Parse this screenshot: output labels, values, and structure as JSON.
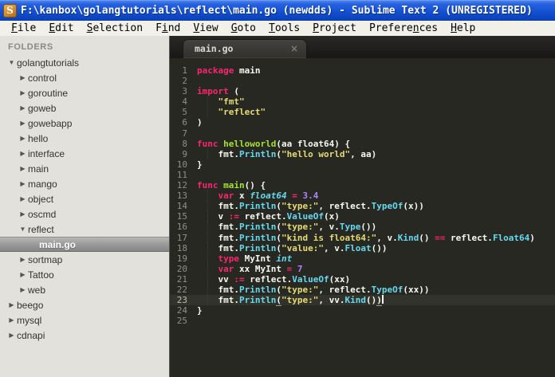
{
  "window": {
    "title": "F:\\kanbox\\golangtutorials\\reflect\\main.go (newdds) - Sublime Text 2 (UNREGISTERED)",
    "app_icon_letter": "S"
  },
  "menu": {
    "items": [
      {
        "label": "File",
        "u": 0
      },
      {
        "label": "Edit",
        "u": 0
      },
      {
        "label": "Selection",
        "u": 0
      },
      {
        "label": "Find",
        "u": 1
      },
      {
        "label": "View",
        "u": 0
      },
      {
        "label": "Goto",
        "u": 0
      },
      {
        "label": "Tools",
        "u": 0
      },
      {
        "label": "Project",
        "u": 0
      },
      {
        "label": "Preferences",
        "u": 7
      },
      {
        "label": "Help",
        "u": 0
      }
    ]
  },
  "icons": {
    "expanded": "▼",
    "collapsed": "▶",
    "close": "×"
  },
  "sidebar": {
    "header": "FOLDERS",
    "items": [
      {
        "label": "golangtutorials",
        "level": 0,
        "state": "expanded",
        "selected": false
      },
      {
        "label": "control",
        "level": 1,
        "state": "collapsed",
        "selected": false
      },
      {
        "label": "goroutine",
        "level": 1,
        "state": "collapsed",
        "selected": false
      },
      {
        "label": "goweb",
        "level": 1,
        "state": "collapsed",
        "selected": false
      },
      {
        "label": "gowebapp",
        "level": 1,
        "state": "collapsed",
        "selected": false
      },
      {
        "label": "hello",
        "level": 1,
        "state": "collapsed",
        "selected": false
      },
      {
        "label": "interface",
        "level": 1,
        "state": "collapsed",
        "selected": false
      },
      {
        "label": "main",
        "level": 1,
        "state": "collapsed",
        "selected": false
      },
      {
        "label": "mango",
        "level": 1,
        "state": "collapsed",
        "selected": false
      },
      {
        "label": "object",
        "level": 1,
        "state": "collapsed",
        "selected": false
      },
      {
        "label": "oscmd",
        "level": 1,
        "state": "collapsed",
        "selected": false
      },
      {
        "label": "reflect",
        "level": 1,
        "state": "expanded",
        "selected": false
      },
      {
        "label": "main.go",
        "level": 2,
        "state": "file",
        "selected": true
      },
      {
        "label": "sortmap",
        "level": 1,
        "state": "collapsed",
        "selected": false
      },
      {
        "label": "Tattoo",
        "level": 1,
        "state": "collapsed",
        "selected": false
      },
      {
        "label": "web",
        "level": 1,
        "state": "collapsed",
        "selected": false
      },
      {
        "label": "beego",
        "level": 0,
        "state": "collapsed",
        "selected": false
      },
      {
        "label": "mysql",
        "level": 0,
        "state": "collapsed",
        "selected": false
      },
      {
        "label": "cdnapi",
        "level": 0,
        "state": "collapsed",
        "selected": false
      }
    ]
  },
  "tab": {
    "label": "main.go",
    "active": true
  },
  "editor": {
    "language": "Go",
    "total_lines": 25,
    "current_line": 23,
    "cursor_line": 23,
    "lines": [
      [
        {
          "t": "package",
          "c": "k"
        },
        {
          "t": " main",
          "c": "p"
        }
      ],
      [],
      [
        {
          "t": "import",
          "c": "k"
        },
        {
          "t": " (",
          "c": "p"
        }
      ],
      [
        {
          "t": "    ",
          "c": "p"
        },
        {
          "t": "\"fmt\"",
          "c": "s"
        }
      ],
      [
        {
          "t": "    ",
          "c": "p"
        },
        {
          "t": "\"reflect\"",
          "c": "s"
        }
      ],
      [
        {
          "t": ")",
          "c": "p"
        }
      ],
      [],
      [
        {
          "t": "func ",
          "c": "k"
        },
        {
          "t": "helloworld",
          "c": "g"
        },
        {
          "t": "(aa float64) {",
          "c": "p"
        }
      ],
      [
        {
          "t": "    ",
          "c": "p"
        },
        {
          "t": "fmt.",
          "c": "p"
        },
        {
          "t": "Println",
          "c": "c"
        },
        {
          "t": "(",
          "c": "p"
        },
        {
          "t": "\"hello world\"",
          "c": "s"
        },
        {
          "t": ", aa)",
          "c": "p"
        }
      ],
      [
        {
          "t": "}",
          "c": "p"
        }
      ],
      [],
      [
        {
          "t": "func ",
          "c": "k"
        },
        {
          "t": "main",
          "c": "g"
        },
        {
          "t": "() {",
          "c": "p"
        }
      ],
      [
        {
          "t": "    ",
          "c": "p"
        },
        {
          "t": "var",
          "c": "k"
        },
        {
          "t": " x ",
          "c": "p"
        },
        {
          "t": "float64",
          "c": "ci"
        },
        {
          "t": " ",
          "c": "p"
        },
        {
          "t": "=",
          "c": "k"
        },
        {
          "t": " ",
          "c": "p"
        },
        {
          "t": "3.4",
          "c": "n"
        }
      ],
      [
        {
          "t": "    ",
          "c": "p"
        },
        {
          "t": "fmt.",
          "c": "p"
        },
        {
          "t": "Println",
          "c": "c"
        },
        {
          "t": "(",
          "c": "p"
        },
        {
          "t": "\"type:\"",
          "c": "s"
        },
        {
          "t": ", reflect.",
          "c": "p"
        },
        {
          "t": "TypeOf",
          "c": "c"
        },
        {
          "t": "(x))",
          "c": "p"
        }
      ],
      [
        {
          "t": "    ",
          "c": "p"
        },
        {
          "t": "v ",
          "c": "p"
        },
        {
          "t": ":=",
          "c": "k"
        },
        {
          "t": " reflect.",
          "c": "p"
        },
        {
          "t": "ValueOf",
          "c": "c"
        },
        {
          "t": "(x)",
          "c": "p"
        }
      ],
      [
        {
          "t": "    ",
          "c": "p"
        },
        {
          "t": "fmt.",
          "c": "p"
        },
        {
          "t": "Println",
          "c": "c"
        },
        {
          "t": "(",
          "c": "p"
        },
        {
          "t": "\"type:\"",
          "c": "s"
        },
        {
          "t": ", v.",
          "c": "p"
        },
        {
          "t": "Type",
          "c": "c"
        },
        {
          "t": "())",
          "c": "p"
        }
      ],
      [
        {
          "t": "    ",
          "c": "p"
        },
        {
          "t": "fmt.",
          "c": "p"
        },
        {
          "t": "Println",
          "c": "c"
        },
        {
          "t": "(",
          "c": "p"
        },
        {
          "t": "\"kind is float64:\"",
          "c": "s"
        },
        {
          "t": ", v.",
          "c": "p"
        },
        {
          "t": "Kind",
          "c": "c"
        },
        {
          "t": "() ",
          "c": "p"
        },
        {
          "t": "==",
          "c": "k"
        },
        {
          "t": " reflect.",
          "c": "p"
        },
        {
          "t": "Float64",
          "c": "c"
        },
        {
          "t": ")",
          "c": "p"
        }
      ],
      [
        {
          "t": "    ",
          "c": "p"
        },
        {
          "t": "fmt.",
          "c": "p"
        },
        {
          "t": "Println",
          "c": "c"
        },
        {
          "t": "(",
          "c": "p"
        },
        {
          "t": "\"value:\"",
          "c": "s"
        },
        {
          "t": ", v.",
          "c": "p"
        },
        {
          "t": "Float",
          "c": "c"
        },
        {
          "t": "())",
          "c": "p"
        }
      ],
      [
        {
          "t": "    ",
          "c": "p"
        },
        {
          "t": "type",
          "c": "k"
        },
        {
          "t": " MyInt ",
          "c": "p"
        },
        {
          "t": "int",
          "c": "ci"
        }
      ],
      [
        {
          "t": "    ",
          "c": "p"
        },
        {
          "t": "var",
          "c": "k"
        },
        {
          "t": " xx MyInt ",
          "c": "p"
        },
        {
          "t": "=",
          "c": "k"
        },
        {
          "t": " ",
          "c": "p"
        },
        {
          "t": "7",
          "c": "n"
        }
      ],
      [
        {
          "t": "    ",
          "c": "p"
        },
        {
          "t": "vv ",
          "c": "p"
        },
        {
          "t": ":=",
          "c": "k"
        },
        {
          "t": " reflect.",
          "c": "p"
        },
        {
          "t": "ValueOf",
          "c": "c"
        },
        {
          "t": "(xx)",
          "c": "p"
        }
      ],
      [
        {
          "t": "    ",
          "c": "p"
        },
        {
          "t": "fmt.",
          "c": "p"
        },
        {
          "t": "Println",
          "c": "c"
        },
        {
          "t": "(",
          "c": "p"
        },
        {
          "t": "\"type:\"",
          "c": "s"
        },
        {
          "t": ", reflect.",
          "c": "p"
        },
        {
          "t": "TypeOf",
          "c": "c"
        },
        {
          "t": "(xx))",
          "c": "p"
        }
      ],
      [
        {
          "t": "    ",
          "c": "p"
        },
        {
          "t": "fmt.",
          "c": "p"
        },
        {
          "t": "Println",
          "c": "c"
        },
        {
          "t": "(",
          "c": "p",
          "u": true
        },
        {
          "t": "\"type:\"",
          "c": "s"
        },
        {
          "t": ", vv.",
          "c": "p"
        },
        {
          "t": "Kind",
          "c": "c"
        },
        {
          "t": "()",
          "c": "p"
        },
        {
          "t": ")",
          "c": "p",
          "u": true
        }
      ],
      [
        {
          "t": "}",
          "c": "p"
        }
      ],
      []
    ]
  },
  "colors": {
    "titlebar_blue": "#1450d2",
    "menubar_bg": "#f1f0e9",
    "sidebar_bg": "#e2e1dc",
    "editor_bg": "#272822",
    "keyword": "#f92672",
    "function_name": "#a6e22e",
    "string": "#e6db74",
    "call_type": "#66d9ef",
    "number": "#ae81ff",
    "plain_text": "#f8f8f2",
    "line_number": "#8f9084"
  }
}
